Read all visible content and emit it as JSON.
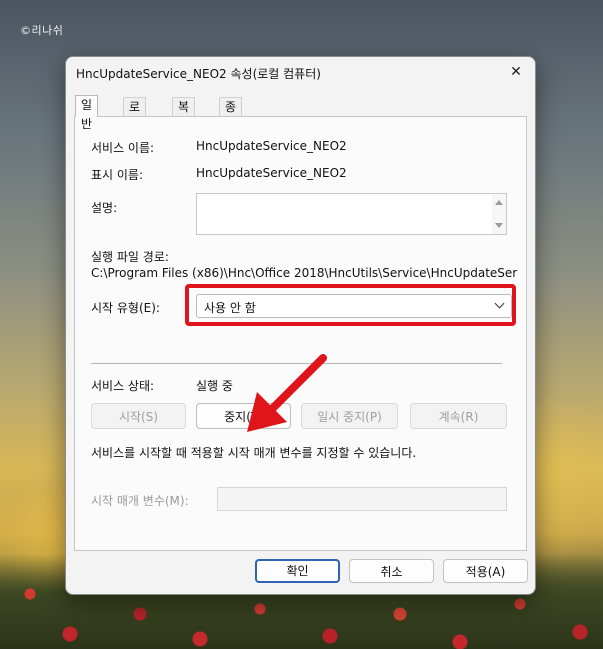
{
  "watermark": "©리나쉬",
  "dialog": {
    "title": "HncUpdateService_NEO2 속성(로컬 컴퓨터)",
    "close_glyph": "✕",
    "tabs": [
      "일반",
      "로그온",
      "복구",
      "종속성"
    ],
    "active_tab": "일반",
    "service_name_label": "서비스 이름:",
    "service_name_value": "HncUpdateService_NEO2",
    "display_name_label": "표시 이름:",
    "display_name_value": "HncUpdateService_NEO2",
    "description_label": "설명:",
    "description_value": "",
    "exe_path_label": "실행 파일 경로:",
    "exe_path_value": "C:\\Program Files (x86)\\Hnc\\Office 2018\\HncUtils\\Service\\HncUpdateSer",
    "startup_type_label": "시작 유형(E):",
    "startup_type_value": "사용 안 함",
    "service_status_label": "서비스 상태:",
    "service_status_value": "실행 중",
    "buttons": {
      "start": "시작(S)",
      "stop": "중지(T)",
      "pause": "일시 중지(P)",
      "resume": "계속(R)"
    },
    "hint_text": "서비스를 시작할 때 적용할 시작 매개 변수를 지정할 수 있습니다.",
    "start_params_label": "시작 매개 변수(M):",
    "start_params_value": "",
    "footer": {
      "ok": "확인",
      "cancel": "취소",
      "apply": "적용(A)"
    }
  },
  "colors": {
    "highlight_red": "#e0141b",
    "default_button_border": "#2f64b5"
  },
  "icons": [
    "close-icon",
    "chevron-down-icon",
    "red-arrow-annotation"
  ]
}
